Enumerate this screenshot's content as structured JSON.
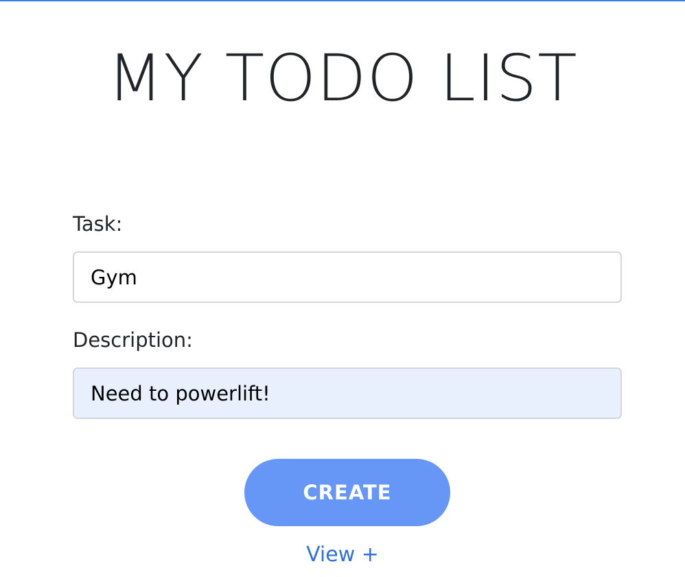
{
  "header": {
    "title": "MY TODO LIST"
  },
  "form": {
    "task": {
      "label": "Task:",
      "value": "Gym"
    },
    "description": {
      "label": "Description:",
      "value": "Need to powerlift!"
    },
    "create_label": "CREATE",
    "view_link_label": "View +"
  },
  "colors": {
    "accent_top_border": "#3b7be8",
    "button_background": "#6697f6",
    "link": "#2f6fde",
    "autofill_background": "#e8f0fe"
  }
}
